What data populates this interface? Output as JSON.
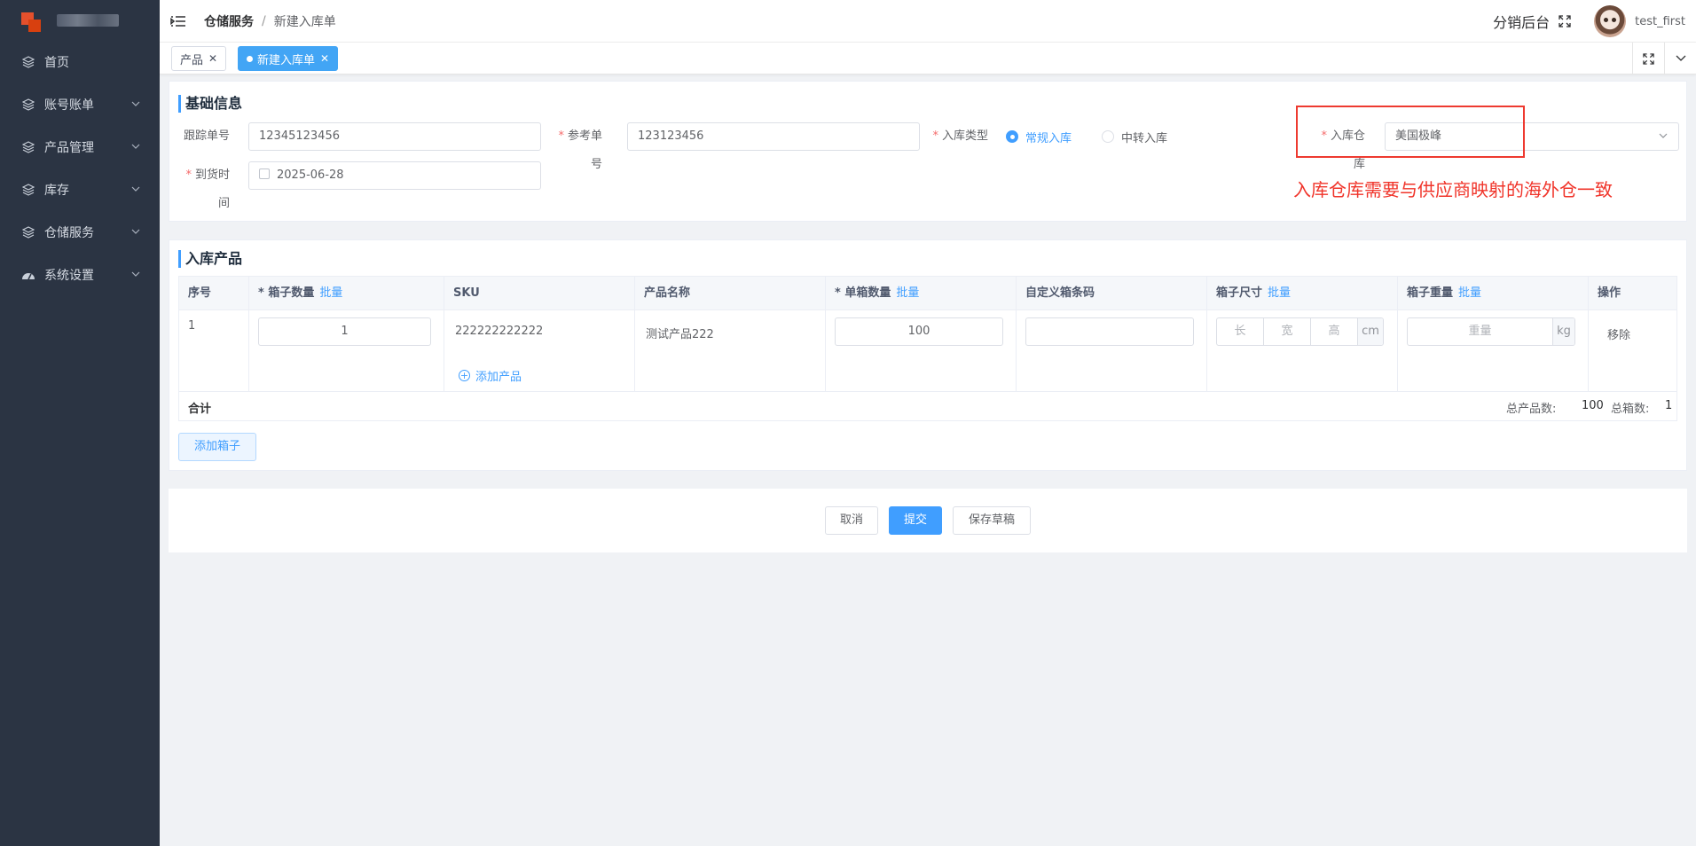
{
  "sidebar": {
    "items": [
      {
        "label": "首页",
        "icon": "layers-icon"
      },
      {
        "label": "账号账单",
        "icon": "layers-icon"
      },
      {
        "label": "产品管理",
        "icon": "layers-icon"
      },
      {
        "label": "库存",
        "icon": "layers-icon"
      },
      {
        "label": "仓储服务",
        "icon": "layers-icon"
      },
      {
        "label": "系统设置",
        "icon": "dashboard-icon"
      }
    ]
  },
  "header": {
    "breadcrumb_parent": "仓储服务",
    "breadcrumb_sep": "/",
    "breadcrumb_current": "新建入库单",
    "distribution_link": "分销后台",
    "username": "test_first"
  },
  "tabs": [
    {
      "label": "产品"
    },
    {
      "label": "新建入库单"
    }
  ],
  "basic_info": {
    "title": "基础信息",
    "tracking_label": "跟踪单号",
    "tracking_value": "12345123456",
    "reference_label": "参考单号",
    "reference_value": "123123456",
    "type_label": "入库类型",
    "type_options": [
      "常规入库",
      "中转入库"
    ],
    "warehouse_label": "入库仓库",
    "warehouse_value": "美国极峰",
    "arrival_label": "到货时间",
    "arrival_value": "2025-06-28",
    "annotation": "入库仓库需要与供应商映射的海外仓一致"
  },
  "products": {
    "title": "入库产品",
    "columns": {
      "index": "序号",
      "box_qty": "箱子数量",
      "sku": "SKU",
      "name": "产品名称",
      "unit_qty": "单箱数量",
      "barcode": "自定义箱条码",
      "size": "箱子尺寸",
      "weight": "箱子重量",
      "action": "操作",
      "batch": "批量",
      "star": "*"
    },
    "row": {
      "index": "1",
      "box_qty": "1",
      "sku": "222222222222",
      "name": "测试产品222",
      "unit_qty": "100",
      "length_ph": "长",
      "width_ph": "宽",
      "height_ph": "高",
      "size_unit": "cm",
      "weight_ph": "重量",
      "weight_unit": "kg",
      "remove": "移除",
      "add_product": "添加产品"
    },
    "footer": {
      "total_label": "合计",
      "total_products_label": "总产品数:",
      "total_products": "100",
      "total_boxes_label": "总箱数:",
      "total_boxes": "1"
    },
    "add_box": "添加箱子"
  },
  "actions": {
    "cancel": "取消",
    "submit": "提交",
    "save_draft": "保存草稿"
  },
  "colors": {
    "primary": "#409eff",
    "sidebar": "#2b3443",
    "annotation": "#f0342a"
  }
}
